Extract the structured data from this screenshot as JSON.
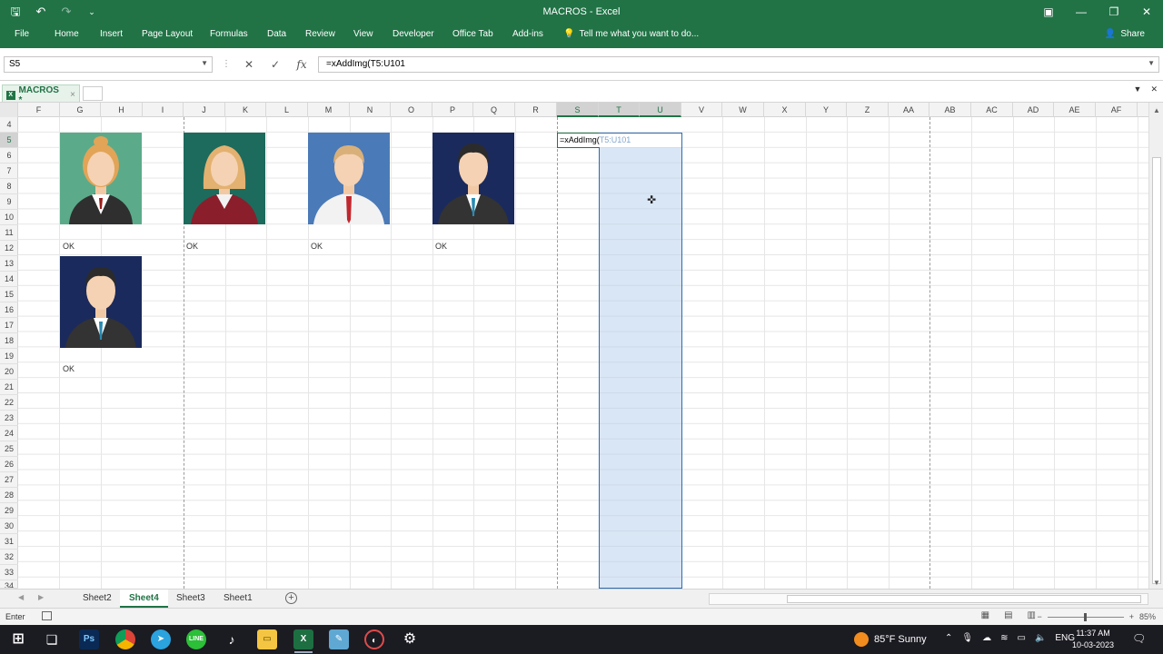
{
  "window": {
    "title": "MACROS - Excel",
    "qat_icons": [
      "save-icon",
      "undo-icon",
      "redo-icon",
      "customize-icon"
    ],
    "controls": [
      "ribbon-display-icon",
      "minimize-icon",
      "restore-icon",
      "close-icon"
    ]
  },
  "ribbon": {
    "tabs": [
      "File",
      "Home",
      "Insert",
      "Page Layout",
      "Formulas",
      "Data",
      "Review",
      "View",
      "Developer",
      "Office Tab",
      "Add-ins"
    ],
    "tell_me": "Tell me what you want to do...",
    "share": "Share"
  },
  "formula_bar": {
    "name_box": "S5",
    "cancel": "✕",
    "enter": "✓",
    "fx": "fx",
    "formula": "=xAddImg(T5:U101"
  },
  "office_tab": {
    "doc_name": "MACROS *",
    "close": "×"
  },
  "grid": {
    "columns": [
      "F",
      "G",
      "H",
      "I",
      "J",
      "K",
      "L",
      "M",
      "N",
      "O",
      "P",
      "Q",
      "R",
      "S",
      "T",
      "U",
      "V",
      "W",
      "X",
      "Y",
      "Z",
      "AA",
      "AB",
      "AC",
      "AD",
      "AE",
      "AF"
    ],
    "rows": [
      "4",
      "5",
      "6",
      "7",
      "8",
      "9",
      "10",
      "11",
      "12",
      "13",
      "14",
      "15",
      "16",
      "17",
      "18",
      "19",
      "20",
      "21",
      "22",
      "23",
      "24",
      "25",
      "26",
      "27",
      "28",
      "29",
      "30",
      "31",
      "32",
      "33",
      "34"
    ],
    "selected_columns": [
      "S",
      "T",
      "U"
    ],
    "ok_labels": [
      "OK",
      "OK",
      "OK",
      "OK",
      "OK"
    ],
    "edit_prefix": "=xAddImg(",
    "edit_ref": "T5:U101"
  },
  "avatars": [
    {
      "bg": "#5bab8a",
      "hair": "#e2a457",
      "suit": "#2f2f2f",
      "shirt": "#ffffff",
      "tie": "#9b1c1c"
    },
    {
      "bg": "#1d6b5c",
      "hair": "#e3b170",
      "suit": "#8b1e2b",
      "shirt": "#f2f2f2",
      "tie": "#8b1e2b"
    },
    {
      "bg": "#4a7ab8",
      "hair": "#d9b07a",
      "suit": "#f2f2f2",
      "shirt": "#ffffff",
      "tie": "#c0272d"
    },
    {
      "bg": "#1b2a5c",
      "hair": "#2b2b2b",
      "suit": "#333333",
      "shirt": "#ffffff",
      "tie": "#2a8ab0"
    },
    {
      "bg": "#1b2a5c",
      "hair": "#2b2b2b",
      "suit": "#333333",
      "shirt": "#ffffff",
      "tie": "#2a8ab0"
    }
  ],
  "sheets": {
    "tabs": [
      "Sheet2",
      "Sheet4",
      "Sheet3",
      "Sheet1"
    ],
    "active": "Sheet4"
  },
  "status": {
    "mode": "Enter",
    "zoom": "85%"
  },
  "taskbar": {
    "apps": [
      "windows-start-icon",
      "task-view-icon",
      "photoshop-icon",
      "chrome-icon",
      "telegram-icon",
      "line-icon",
      "tiktok-icon",
      "file-explorer-icon",
      "excel-icon",
      "notepad-icon",
      "browser-icon",
      "settings-icon"
    ],
    "weather": "85°F  Sunny",
    "language": "ENG",
    "time": "11:37 AM",
    "date": "10-03-2023"
  }
}
